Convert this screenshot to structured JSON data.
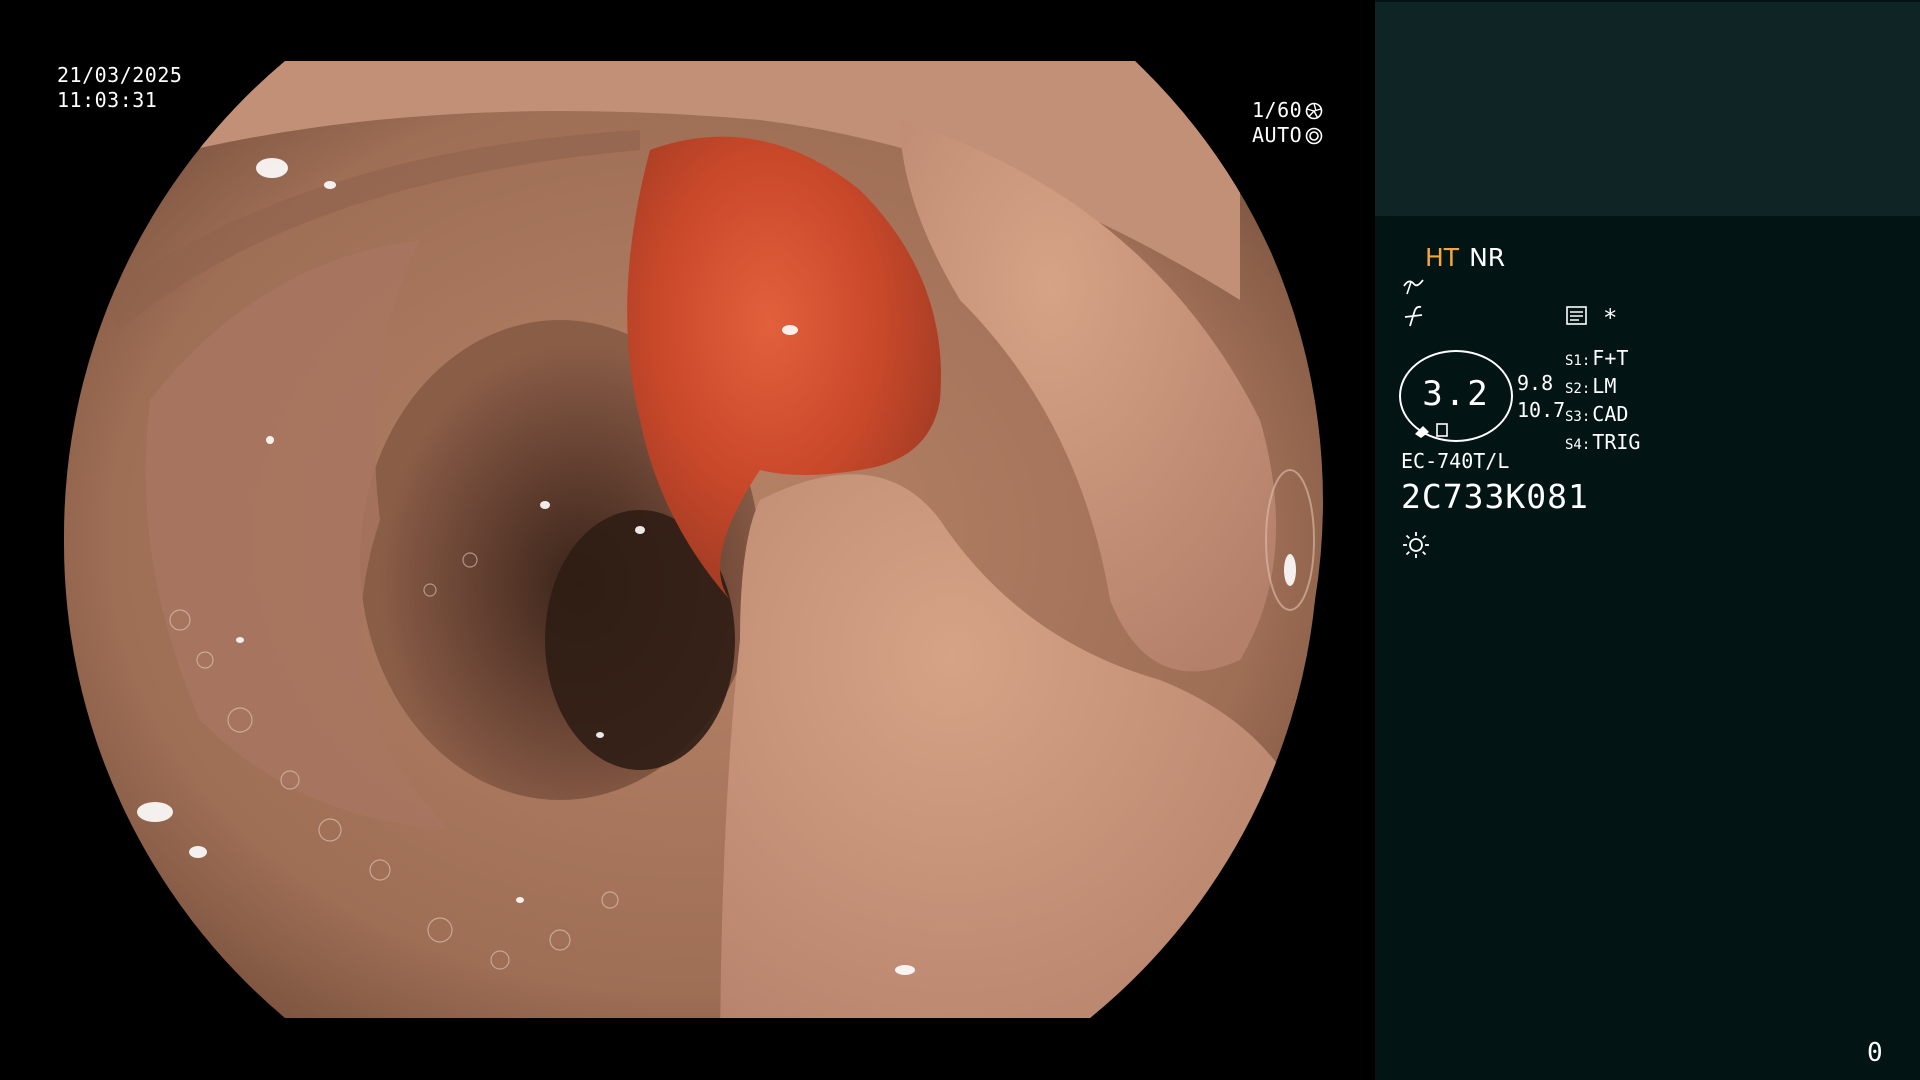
{
  "overlay": {
    "date": "21/03/2025",
    "time": "11:03:31",
    "shutter_speed": "1/60",
    "iris_mode": "AUTO",
    "shutter_icon": "aperture-icon",
    "iris_icon": "iris-icon"
  },
  "side_panel": {
    "mode_primary": "HT",
    "mode_secondary": "NR",
    "mode_primary_color": "#f2a93b",
    "structure_icon": "structure-enhancement-icon",
    "color_icon": "color-enhancement-icon",
    "memo_icon": "memo-icon",
    "star": "*",
    "zoom_value": "3.2",
    "zoom_range": [
      "9.8",
      "10.7"
    ],
    "presets": [
      {
        "key": "S1:",
        "value": "F+T"
      },
      {
        "key": "S2:",
        "value": "LM"
      },
      {
        "key": "S3:",
        "value": "CAD"
      },
      {
        "key": "S4:",
        "value": "TRIG"
      }
    ],
    "scope_model": "EC-740T/L",
    "scope_serial": "2C733K081",
    "light_icon": "light-source-icon",
    "counter": "0",
    "panel_color": "#031414",
    "panel_top_color": "#0e2425"
  }
}
